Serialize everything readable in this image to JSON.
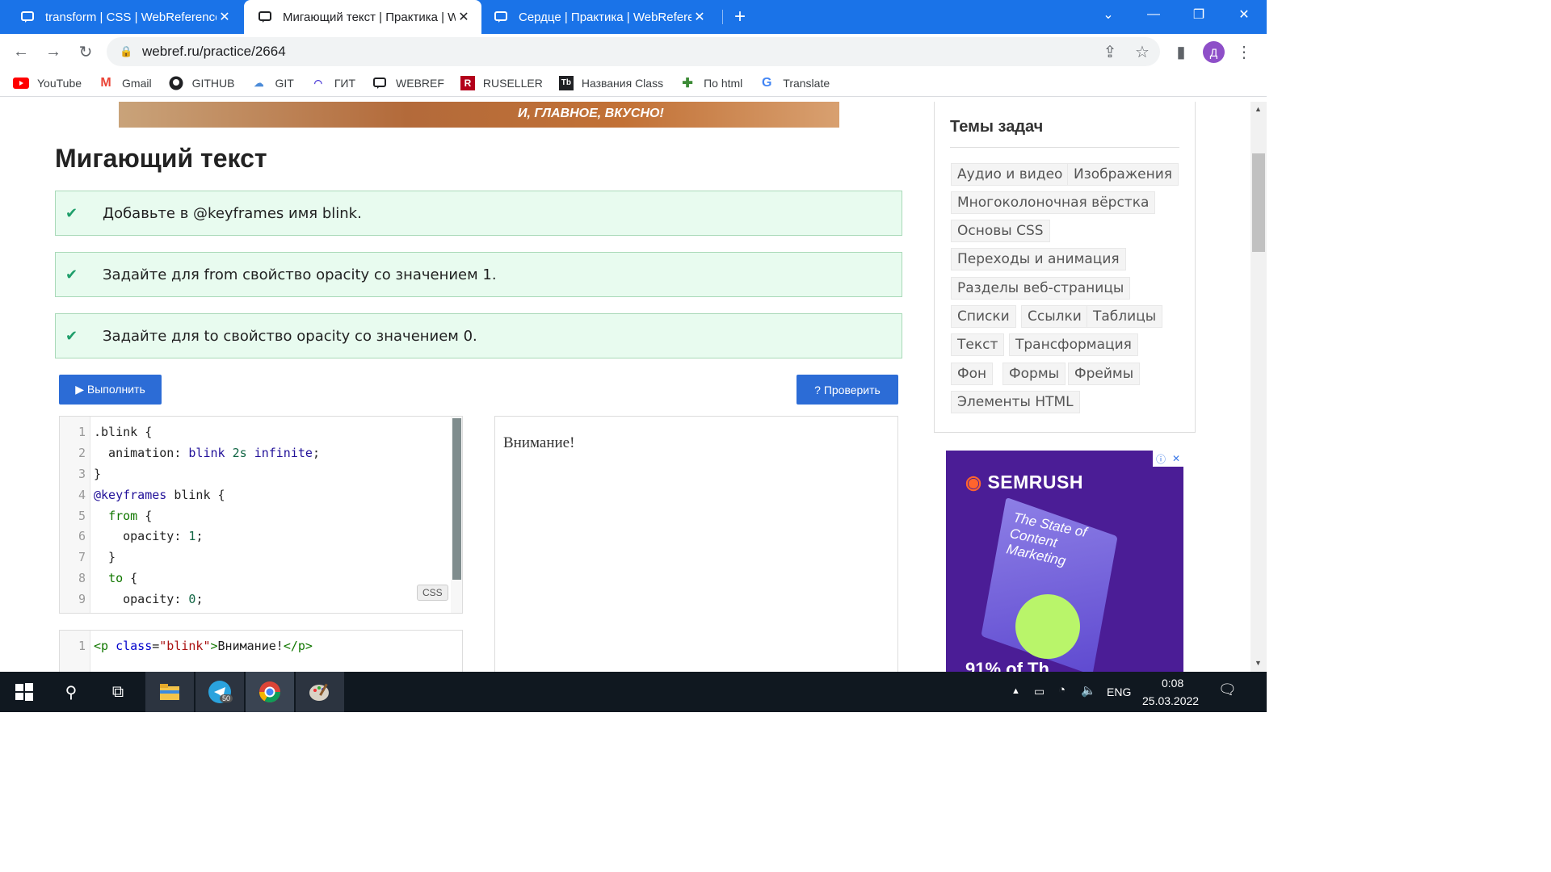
{
  "browser": {
    "tabs": [
      {
        "title": "transform | CSS | WebReference",
        "close": "✕"
      },
      {
        "title": "Мигающий текст | Практика | W",
        "close": "✕"
      },
      {
        "title": "Сердце | Практика | WebReferen",
        "close": "✕"
      }
    ],
    "new_tab": "+",
    "url": "webref.ru/practice/2664",
    "profile_initial": "Д"
  },
  "bookmarks": [
    {
      "label": "YouTube",
      "icon": "youtube-icon",
      "color": "#ff0000"
    },
    {
      "label": "Gmail",
      "icon": "gmail-icon",
      "color": "#ea4335"
    },
    {
      "label": "GITHUB",
      "icon": "github-icon",
      "color": "#202124"
    },
    {
      "label": "GIT",
      "icon": "git-icon",
      "color": "#4b8bd8"
    },
    {
      "label": "ГИТ",
      "icon": "git-icon",
      "color": "#4b3bd8"
    },
    {
      "label": "WEBREF",
      "icon": "webref-icon",
      "color": "#202124"
    },
    {
      "label": "RUSELLER",
      "icon": "ruseller-icon",
      "color": "#b3001b"
    },
    {
      "label": "Названия Class",
      "icon": "tb-icon",
      "color": "#202124"
    },
    {
      "label": "По html",
      "icon": "puzzle-icon",
      "color": "#3d8b37"
    },
    {
      "label": "Translate",
      "icon": "google-icon",
      "color": "#4285f4"
    }
  ],
  "page": {
    "banner_text": "И, ГЛАВНОЕ, ВКУСНО!",
    "title": "Мигающий текст",
    "tasks": [
      "Добавьте в @keyframes имя blink.",
      "Задайте для from свойство opacity со значением 1.",
      "Задайте для to свойство opacity со значением 0."
    ],
    "run_label": "▶ Выполнить",
    "check_label": "? Проверить",
    "css_badge": "CSS",
    "preview_text": "Внимание!"
  },
  "sidebar": {
    "title": "Темы задач",
    "topics": [
      "Аудио и видео",
      "Изображения",
      "Многоколоночная вёрстка",
      "Основы CSS",
      "Переходы и анимация",
      "Разделы веб-страницы",
      "Списки",
      "Ссылки",
      "Таблицы",
      "Текст",
      "Трансформация",
      "Фон",
      "Формы",
      "Фреймы",
      "Элементы HTML"
    ]
  },
  "ad": {
    "brand": "SEMRUSH",
    "book_title": "The State of Content Marketing",
    "tagline": "91% of Th"
  },
  "taskbar": {
    "time": "0:08",
    "date": "25.03.2022",
    "lang": "ENG",
    "telegram_badge": "50"
  }
}
